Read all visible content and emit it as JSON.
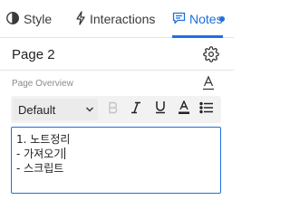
{
  "tabs": {
    "style": "Style",
    "interactions": "Interactions",
    "notes": "Notes"
  },
  "page": {
    "title": "Page 2"
  },
  "notes_panel": {
    "overview_label": "Page Overview",
    "font_select_value": "Default",
    "editor_lines": [
      "1. 노트정리",
      "- 가져오기",
      "- 스크립트"
    ]
  },
  "colors": {
    "accent": "#1f6fe0",
    "active_tab": "#1f6fe0"
  },
  "icons": [
    "brush-icon",
    "lightning-icon",
    "notes-icon",
    "gear-icon",
    "text-style-icon",
    "chevron-down-icon",
    "bold-icon",
    "italic-icon",
    "underline-icon",
    "text-color-icon",
    "bulleted-list-icon"
  ]
}
